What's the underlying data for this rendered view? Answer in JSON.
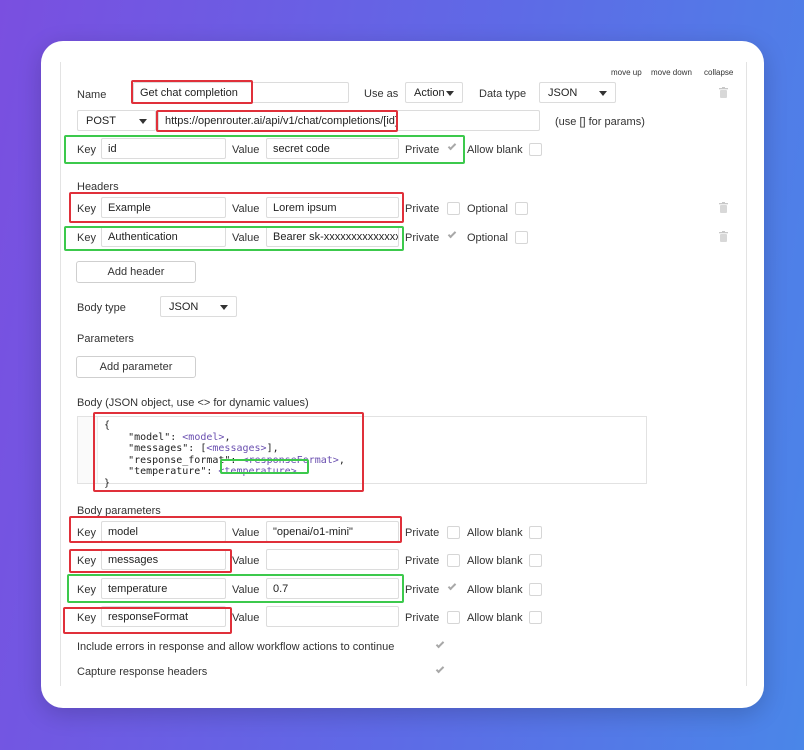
{
  "top_actions": {
    "move_up": "move up",
    "move_down": "move down",
    "collapse": "collapse"
  },
  "name_row": {
    "name_label": "Name",
    "name_value": "Get chat completion",
    "use_as_label": "Use as",
    "use_as_value": "Action",
    "data_type_label": "Data type",
    "data_type_value": "JSON"
  },
  "url_row": {
    "method": "POST",
    "url": "https://openrouter.ai/api/v1/chat/completions/[id]",
    "hint": "(use [] for params)"
  },
  "param_row": {
    "key_label": "Key",
    "key": "id",
    "value_label": "Value",
    "value": "secret code",
    "private_label": "Private",
    "private_checked": true,
    "allow_blank_label": "Allow blank"
  },
  "headers": {
    "title": "Headers",
    "rows": [
      {
        "key_label": "Key",
        "key": "Example",
        "value_label": "Value",
        "value": "Lorem ipsum",
        "private_label": "Private",
        "private_checked": false,
        "optional_label": "Optional"
      },
      {
        "key_label": "Key",
        "key": "Authentication",
        "value_label": "Value",
        "value": "Bearer sk-xxxxxxxxxxxxxxxx",
        "private_label": "Private",
        "private_checked": true,
        "optional_label": "Optional"
      }
    ],
    "add_button": "Add header"
  },
  "body_type": {
    "label": "Body type",
    "value": "JSON"
  },
  "parameters": {
    "title": "Parameters",
    "add_button": "Add parameter"
  },
  "body": {
    "label": "Body (JSON object, use <> for dynamic values)",
    "lines": [
      "{",
      "    \"model\": <model>,",
      "    \"messages\": [<messages>],",
      "    \"response_format\": <responseFormat>,",
      "    \"temperature\": <temperature>",
      "}"
    ]
  },
  "body_parameters": {
    "title": "Body parameters",
    "rows": [
      {
        "key_label": "Key",
        "key": "model",
        "value_label": "Value",
        "value": "\"openai/o1-mini\"",
        "private_label": "Private",
        "private_checked": false,
        "allow_blank_label": "Allow blank"
      },
      {
        "key_label": "Key",
        "key": "messages",
        "value_label": "Value",
        "value": "",
        "private_label": "Private",
        "private_checked": false,
        "allow_blank_label": "Allow blank"
      },
      {
        "key_label": "Key",
        "key": "temperature",
        "value_label": "Value",
        "value": "0.7",
        "private_label": "Private",
        "private_checked": true,
        "allow_blank_label": "Allow blank"
      },
      {
        "key_label": "Key",
        "key": "responseFormat",
        "value_label": "Value",
        "value": "",
        "private_label": "Private",
        "private_checked": false,
        "allow_blank_label": "Allow blank"
      }
    ]
  },
  "options": {
    "include_errors": "Include errors in response and allow workflow actions to continue",
    "capture_headers": "Capture response headers"
  },
  "colors": {
    "highlight_red": "#e0303a",
    "highlight_green": "#3cc94c",
    "bg_start": "#7a4fe0",
    "bg_end": "#4a86e8"
  }
}
